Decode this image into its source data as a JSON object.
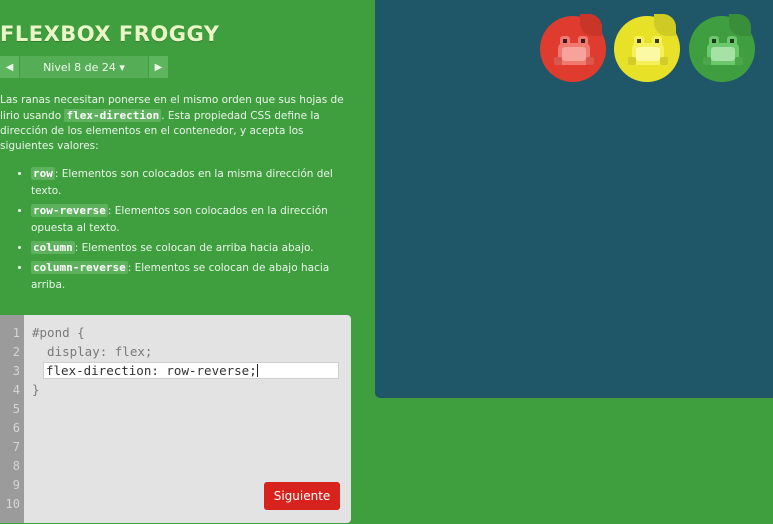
{
  "game": {
    "title": "FLEXBOX FROGGY",
    "level": {
      "label": "Nivel 8 de 24 ▾",
      "prev_symbol": "◀",
      "next_symbol": "▶"
    },
    "instructions": {
      "intro_before": "Las ranas necesitan ponerse en el mismo orden que sus hojas de lirio usando ",
      "intro_code": "flex-direction",
      "intro_after": ". Esta propiedad CSS define la dirección de los elementos en el contenedor, y acepta los siguientes valores:",
      "values": [
        {
          "code": "row",
          "text": ": Elementos son colocados en la misma dirección del texto."
        },
        {
          "code": "row-reverse",
          "text": ": Elementos son colocados en la dirección opuesta al texto."
        },
        {
          "code": "column",
          "text": ": Elementos se colocan de arriba hacia abajo."
        },
        {
          "code": "column-reverse",
          "text": ": Elementos se colocan de abajo hacia arriba."
        }
      ]
    },
    "editor": {
      "line_numbers": [
        "1",
        "2",
        "3",
        "4",
        "5",
        "6",
        "7",
        "8",
        "9",
        "10"
      ],
      "line1": "#pond {",
      "line2": "  display: flex;",
      "input_value": "flex-direction: row-reverse;",
      "line4": "}",
      "next_label": "Siguiente"
    },
    "pond": {
      "lilypads": [
        {
          "color": "red",
          "hex": "#e03b2f"
        },
        {
          "color": "yellow",
          "hex": "#e7e228"
        },
        {
          "color": "green",
          "hex": "#3f9e3f"
        }
      ],
      "frogs": [
        {
          "color": "red",
          "hex": "#f07a70"
        },
        {
          "color": "yellow",
          "hex": "#f7f36a"
        },
        {
          "color": "green",
          "hex": "#7fd17f"
        }
      ]
    },
    "colors": {
      "background": "#3f9f3f",
      "pond": "#1f5768",
      "accent_button": "#d8231c"
    }
  }
}
